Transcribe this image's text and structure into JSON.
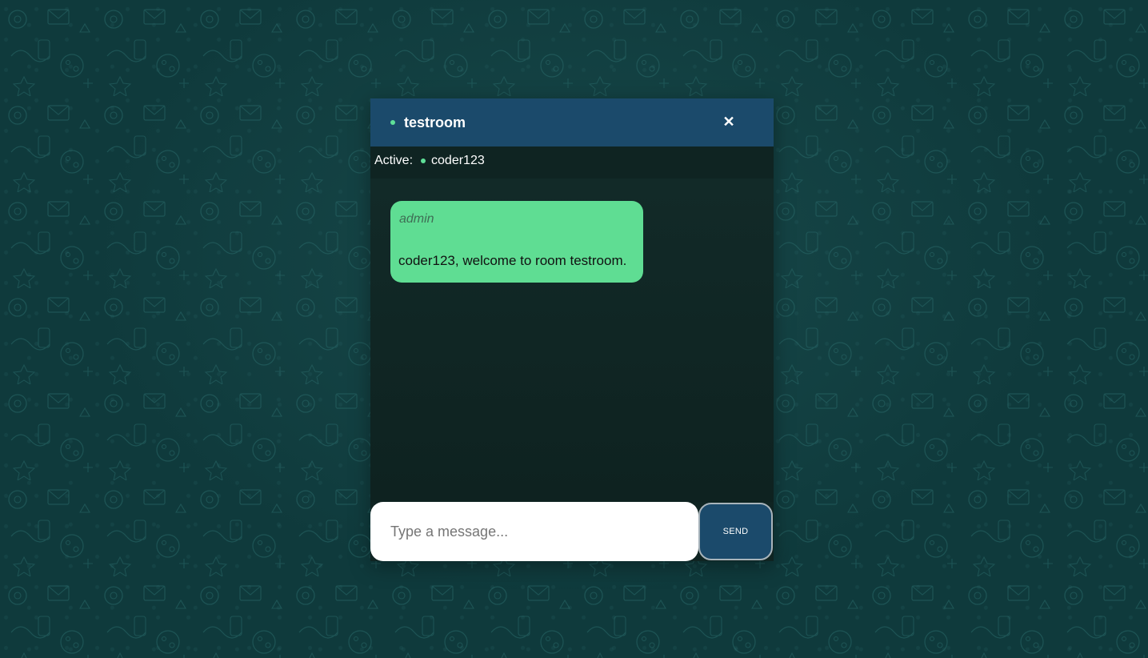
{
  "colors": {
    "background": "#0f3a3c",
    "header": "#1b4a6b",
    "online_dot": "#5fe098",
    "bubble": "#5fdd93",
    "send_button": "#1b4a6b"
  },
  "chat": {
    "room_name": "testroom",
    "close_icon": "close-icon",
    "active_label": "Active:",
    "active_users": [
      "coder123"
    ],
    "messages": [
      {
        "author": "admin",
        "text": "coder123, welcome to room testroom."
      }
    ],
    "input": {
      "value": "",
      "placeholder": "Type a message..."
    },
    "send_label": "SEND"
  }
}
